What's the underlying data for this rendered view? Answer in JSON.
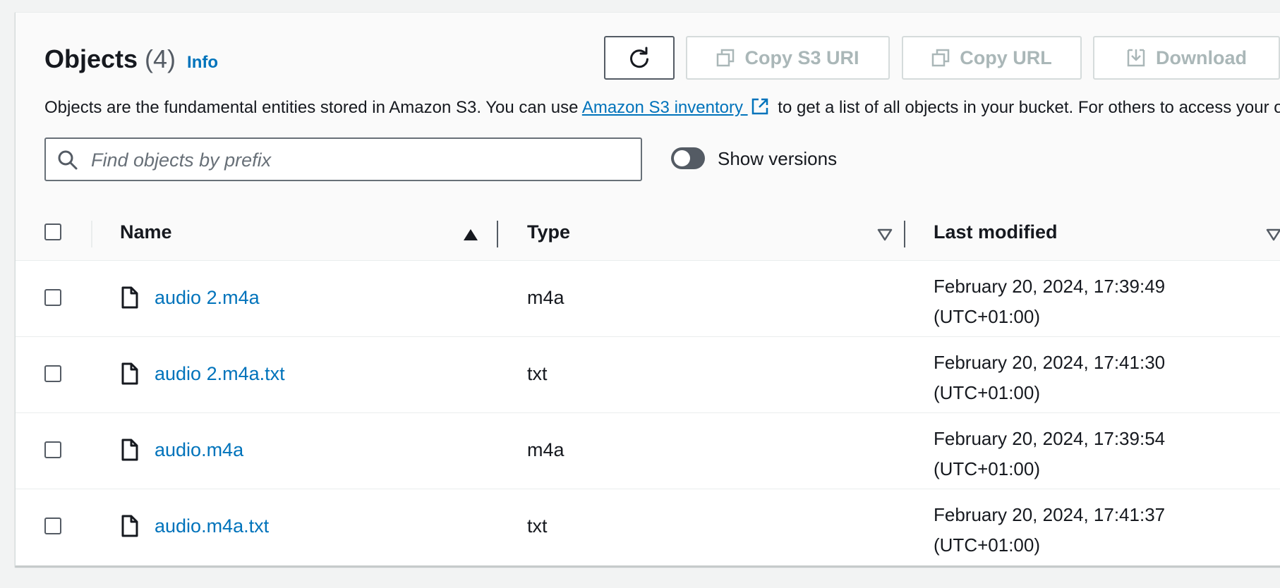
{
  "objects": {
    "title": "Objects",
    "count": "(4)",
    "info_label": "Info",
    "toolbar": {
      "refresh_icon": "refresh-icon",
      "copy_s3_uri_label": "Copy S3 URI",
      "copy_url_label": "Copy URL",
      "download_label": "Download"
    },
    "description": {
      "before_link": "Objects are the fundamental entities stored in Amazon S3. You can use ",
      "link_text": "Amazon S3 inventory ",
      "after_link": " to get a list of all objects in your bucket. For others to access your objects"
    },
    "search": {
      "placeholder": "Find objects by prefix",
      "value": ""
    },
    "show_versions": {
      "label": "Show versions",
      "enabled": false
    },
    "table": {
      "columns": [
        "Name",
        "Type",
        "Last modified"
      ],
      "sort": {
        "column": "Name",
        "direction": "ascending"
      },
      "rows": [
        {
          "name": "audio 2.m4a",
          "type": "m4a",
          "modified_line1": "February 20, 2024, 17:39:49",
          "modified_line2": "(UTC+01:00)"
        },
        {
          "name": "audio 2.m4a.txt",
          "type": "txt",
          "modified_line1": "February 20, 2024, 17:41:30",
          "modified_line2": "(UTC+01:00)"
        },
        {
          "name": "audio.m4a",
          "type": "m4a",
          "modified_line1": "February 20, 2024, 17:39:54",
          "modified_line2": "(UTC+01:00)"
        },
        {
          "name": "audio.m4a.txt",
          "type": "txt",
          "modified_line1": "February 20, 2024, 17:41:37",
          "modified_line2": "(UTC+01:00)"
        }
      ]
    }
  },
  "colors": {
    "link": "#0073bb",
    "text": "#16191f",
    "disabled": "#aab7b8",
    "toggle_off": "#545b64"
  }
}
